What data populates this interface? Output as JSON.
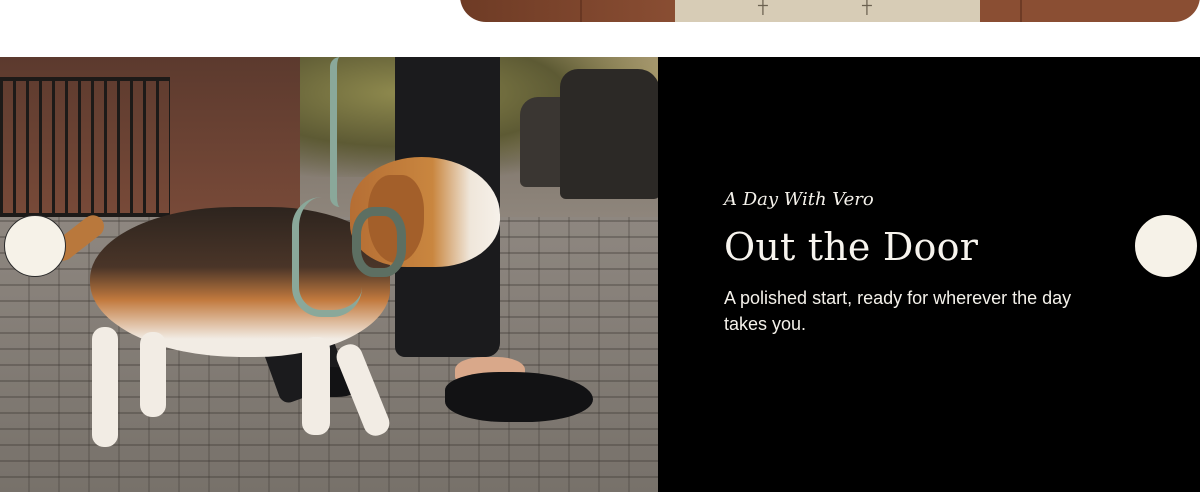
{
  "slide": {
    "eyebrow": "A Day With Vero",
    "title": "Out the Door",
    "description": "A polished start, ready for wherever the day takes you.",
    "image_subject": "beagle-on-leash-walking"
  },
  "carousel": {
    "prev_icon": "circle-prev-icon",
    "next_icon": "circle-next-icon"
  },
  "colors": {
    "panel_bg": "#000000",
    "panel_text": "#f4f1ea",
    "nav_dot": "#f6f2e8",
    "page_bg": "#ffffff"
  }
}
